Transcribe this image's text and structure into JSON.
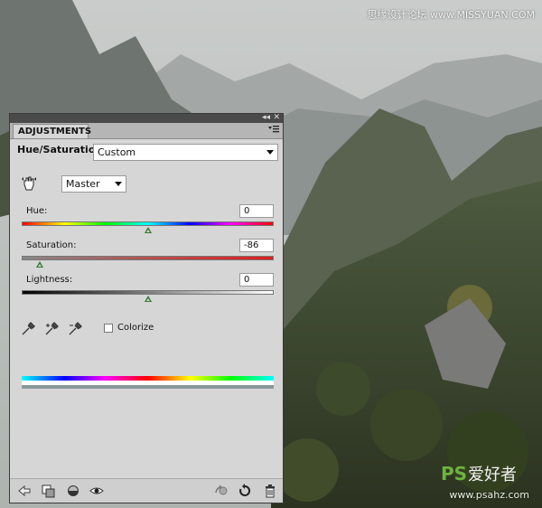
{
  "watermark": {
    "top_text": "思缘设计论坛 www.MISSYUAN.COM",
    "logo_text": "PS爱好者",
    "url_text": "www.psahz.com"
  },
  "panel": {
    "tab_label": "ADJUSTMENTS",
    "title": "Hue/Saturation",
    "preset_value": "Custom",
    "channel_value": "Master",
    "hue": {
      "label": "Hue:",
      "value": "0",
      "slider_fraction": 0.5
    },
    "saturation": {
      "label": "Saturation:",
      "value": "-86",
      "slider_fraction": 0.07
    },
    "lightness": {
      "label": "Lightness:",
      "value": "0",
      "slider_fraction": 0.5
    },
    "colorize_label": "Colorize",
    "colorize_checked": false
  },
  "icons": {
    "targeted_adjust": "hand-icon",
    "eyedropper": "eyedropper-icon",
    "eyedropper_add": "eyedropper-plus-icon",
    "eyedropper_subtract": "eyedropper-minus-icon",
    "back": "back-arrow-icon",
    "clip": "clip-to-layer-icon",
    "mask": "mask-icon",
    "visibility": "eye-icon",
    "previous_state": "previous-state-icon",
    "reset": "reset-icon",
    "delete": "trash-icon"
  },
  "colors": {
    "panel_bg": "#d6d6d6",
    "thumb": "#2f7a2f"
  }
}
